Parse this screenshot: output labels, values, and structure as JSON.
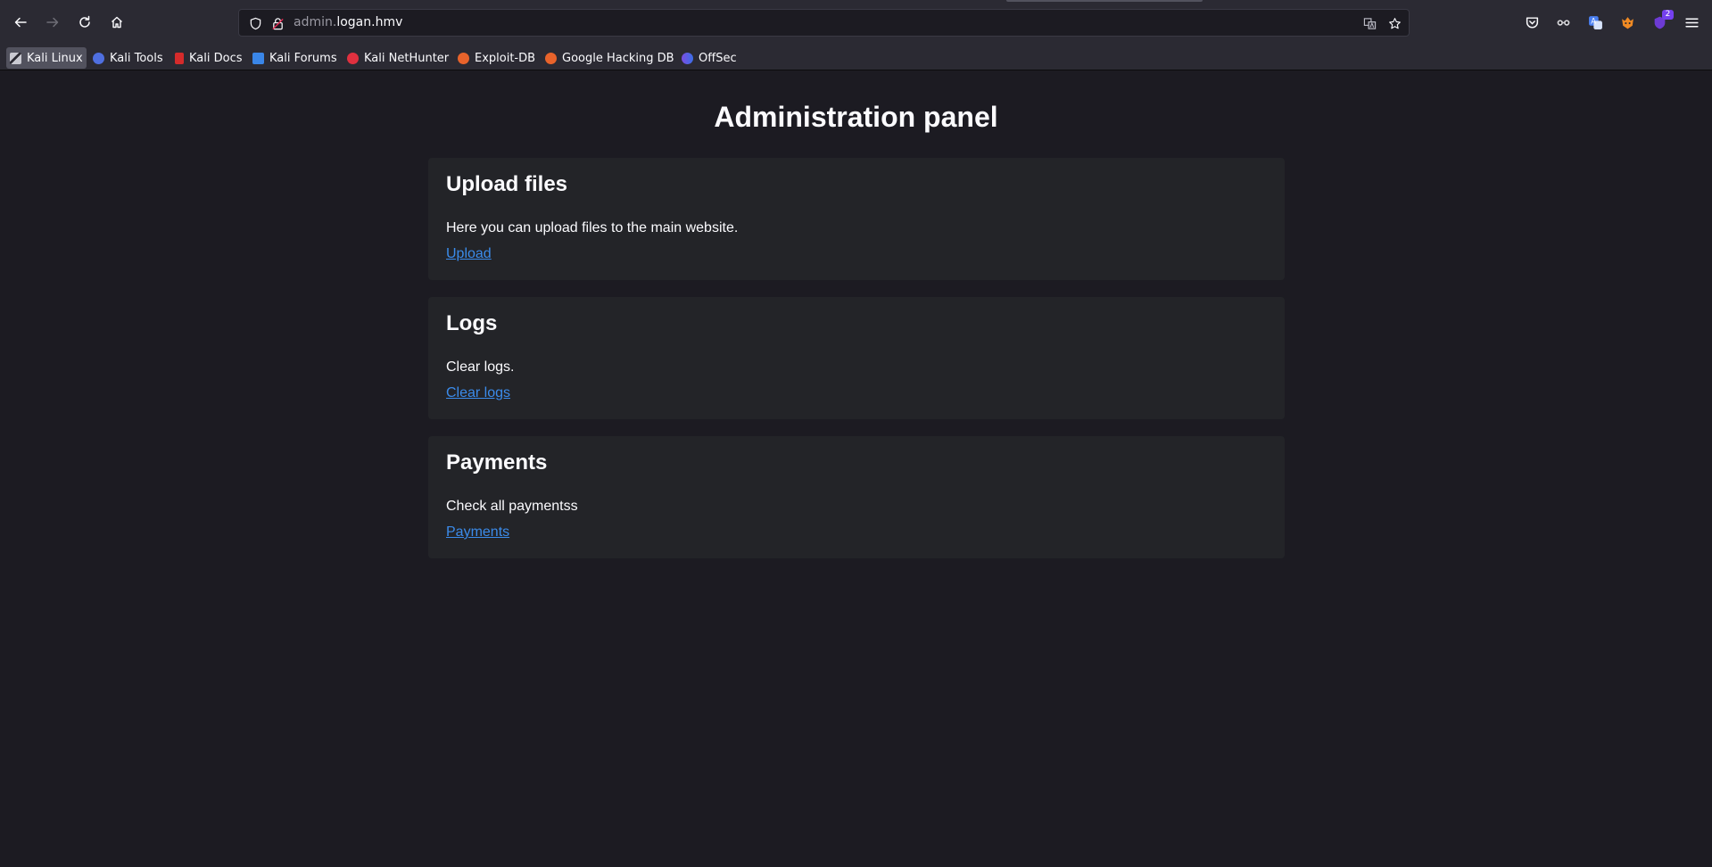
{
  "browser": {
    "address_bar": {
      "url_subdomain": "admin.",
      "url_host": "logan.hmv"
    },
    "extensions_badge_count": "2",
    "colors": {
      "chrome": "#2b2a33",
      "page_bg": "#1c1b22",
      "card_bg": "#232428",
      "link": "#3b8bea",
      "badge": "#7540ef"
    }
  },
  "bookmarks": [
    {
      "label": "Kali Linux",
      "icon": "kali-dragon-icon"
    },
    {
      "label": "Kali Tools",
      "icon": "kali-tools-icon"
    },
    {
      "label": "Kali Docs",
      "icon": "kali-docs-icon"
    },
    {
      "label": "Kali Forums",
      "icon": "kali-forums-icon"
    },
    {
      "label": "Kali NetHunter",
      "icon": "nethunter-icon"
    },
    {
      "label": "Exploit-DB",
      "icon": "exploit-db-icon"
    },
    {
      "label": "Google Hacking DB",
      "icon": "ghdb-icon"
    },
    {
      "label": "OffSec",
      "icon": "offsec-icon"
    }
  ],
  "page": {
    "title": "Administration panel",
    "sections": [
      {
        "heading": "Upload files",
        "description": "Here you can upload files to the main website.",
        "link": "Upload"
      },
      {
        "heading": "Logs",
        "description": "Clear logs.",
        "link": "Clear logs"
      },
      {
        "heading": "Payments",
        "description": "Check all paymentss",
        "link": "Payments"
      }
    ]
  }
}
